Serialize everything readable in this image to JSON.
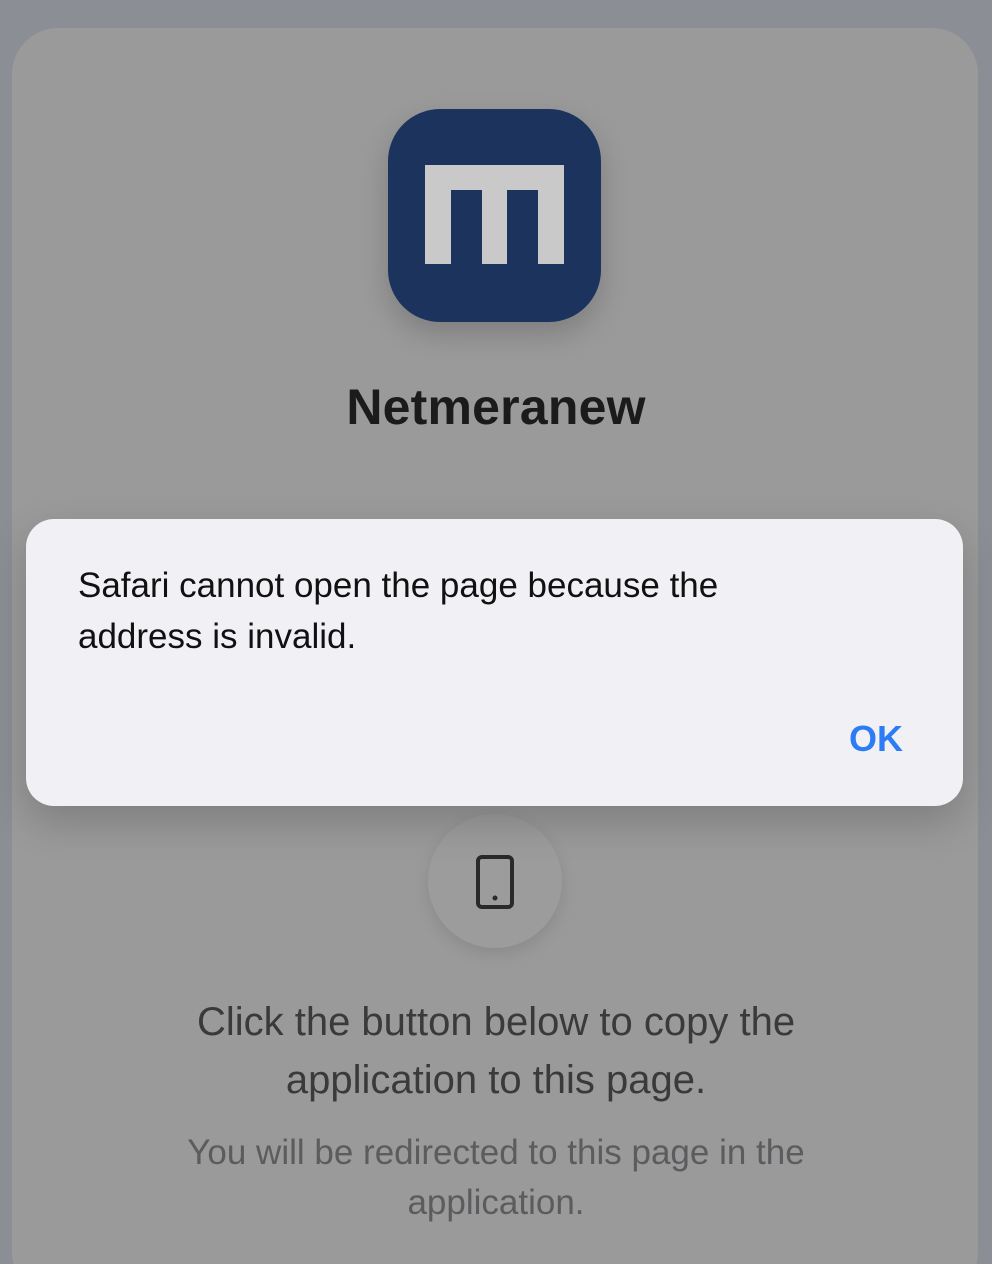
{
  "app": {
    "name": "Netmeranew",
    "icon": "netmera-m-logo-icon",
    "brand_color": "#1c345d"
  },
  "device_icon": "tablet-icon",
  "instruction_text": "Click the button below to copy the application to this page.",
  "redirect_text": "You will be redirected to this page in the application.",
  "alert": {
    "message": "Safari cannot open the page because the address is invalid.",
    "ok_label": "OK",
    "accent_color": "#2c7cf6"
  }
}
